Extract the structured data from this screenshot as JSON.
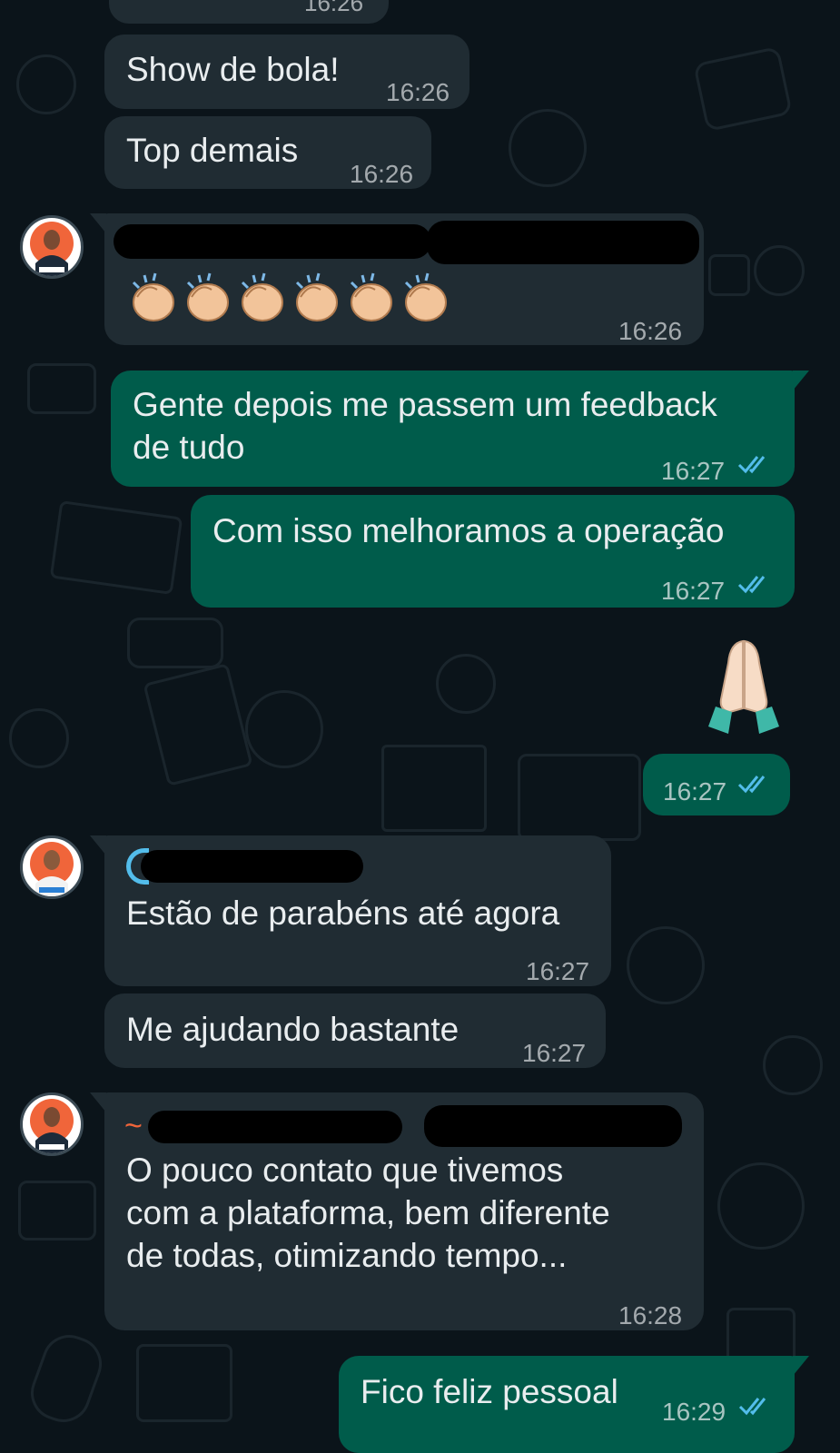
{
  "previous_time_fragment": "16:26",
  "messages": [
    {
      "id": "m1",
      "direction": "incoming",
      "text": "Show de bola!",
      "time": "16:26"
    },
    {
      "id": "m2",
      "direction": "incoming",
      "text": "Top demais",
      "time": "16:26"
    },
    {
      "id": "m3",
      "direction": "incoming",
      "sender": "",
      "emoji": "clapping-hands-x6",
      "time": "16:26"
    },
    {
      "id": "m4",
      "direction": "outgoing",
      "text": "Gente depois me passem um feedback\nde tudo",
      "time": "16:27",
      "status": "read"
    },
    {
      "id": "m5",
      "direction": "outgoing",
      "text": "Com isso melhoramos a operação",
      "time": "16:27",
      "status": "read"
    },
    {
      "id": "m6",
      "direction": "outgoing",
      "emoji": "folded-hands",
      "time": "16:27",
      "status": "read"
    },
    {
      "id": "m7",
      "direction": "incoming",
      "sender": "",
      "text": "Estão de parabéns até agora",
      "time": "16:27"
    },
    {
      "id": "m8",
      "direction": "incoming",
      "text": "Me ajudando bastante",
      "time": "16:27"
    },
    {
      "id": "m9",
      "direction": "incoming",
      "sender": "~",
      "text": "O pouco contato que tivemos\ncom a plataforma, bem diferente\nde todas, otimizando tempo...",
      "time": "16:28"
    },
    {
      "id": "m10",
      "direction": "outgoing",
      "text": "Fico feliz pessoal",
      "time": "16:29",
      "status": "read"
    }
  ],
  "colors": {
    "background": "#0b141a",
    "incoming_bubble": "#202c33",
    "outgoing_bubble": "#005c4b",
    "read_ticks": "#53bdeb",
    "sender_name_orange": "#f0653a",
    "sender_name_blue": "#53bdeb"
  },
  "icons": {
    "read_receipt": "double-check-icon",
    "avatar": "profile-photo"
  }
}
